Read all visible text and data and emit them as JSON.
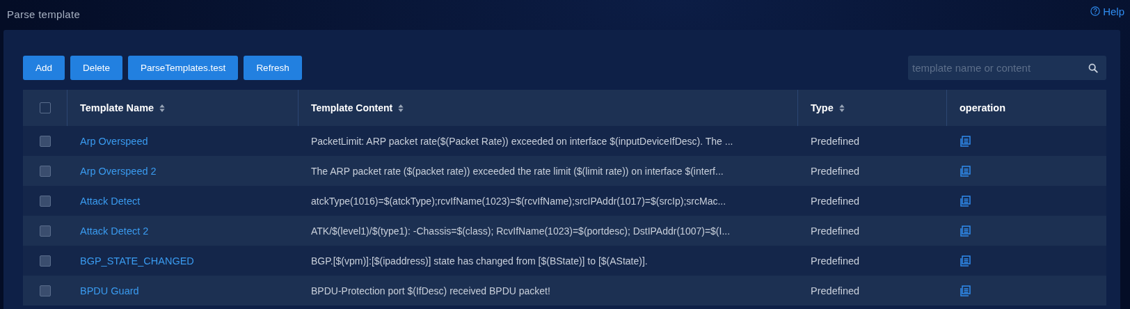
{
  "page": {
    "title": "Parse template",
    "help": "Help"
  },
  "toolbar": {
    "buttons": [
      "Add",
      "Delete",
      "ParseTemplates.test",
      "Refresh"
    ],
    "search": {
      "placeholder": "template name or content"
    }
  },
  "table": {
    "select_all": {
      "checked": false
    },
    "columns": [
      {
        "label": "Template Name",
        "sortable": true
      },
      {
        "label": "Template Content",
        "sortable": true
      },
      {
        "label": "Type",
        "sortable": true
      },
      {
        "label": "operation",
        "sortable": false
      }
    ],
    "rows": [
      {
        "name": "Arp Overspeed",
        "content": "PacketLimit: ARP packet rate($(Packet Rate)) exceeded on interface $(inputDeviceIfDesc). The ...",
        "type": "Predefined",
        "checked": false
      },
      {
        "name": "Arp Overspeed 2",
        "content": "The ARP packet rate ($(packet rate)) exceeded the rate limit ($(limit rate)) on interface $(interf...",
        "type": "Predefined",
        "checked": false
      },
      {
        "name": "Attack Detect",
        "content": "atckType(1016)=$(atckType);rcvIfName(1023)=$(rcvIfName);srcIPAddr(1017)=$(srcIp);srcMac...",
        "type": "Predefined",
        "checked": false
      },
      {
        "name": "Attack Detect 2",
        "content": "ATK/$(level1)/$(type1): -Chassis=$(class); RcvIfName(1023)=$(portdesc); DstIPAddr(1007)=$(I...",
        "type": "Predefined",
        "checked": false
      },
      {
        "name": "BGP_STATE_CHANGED",
        "content": "BGP.[$(vpm)]:[$(ipaddress)] state has changed from [$(BState)] to [$(AState)].",
        "type": "Predefined",
        "checked": false
      },
      {
        "name": "BPDU Guard",
        "content": "BPDU-Protection port $(IfDesc) received BPDU packet!",
        "type": "Predefined",
        "checked": false
      }
    ]
  }
}
